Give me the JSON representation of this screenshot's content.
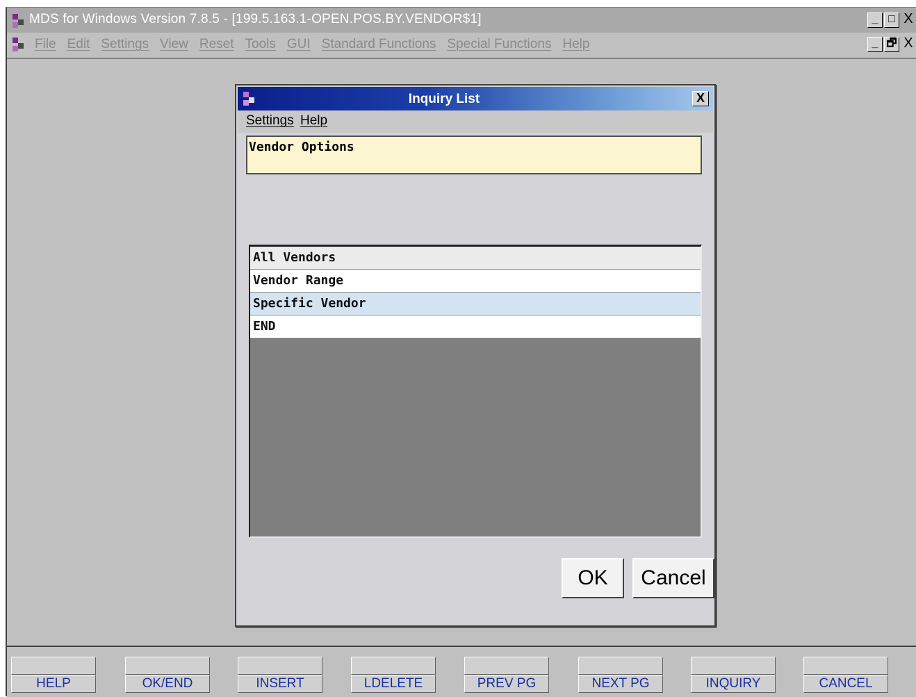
{
  "window": {
    "title": "MDS for Windows Version 7.8.5 - [199.5.163.1-OPEN.POS.BY.VENDOR$1]",
    "controls": {
      "minimize": "_",
      "maximize": "□",
      "restore": "🗗",
      "close": "X"
    }
  },
  "menubar": {
    "items": [
      "File",
      "Edit",
      "Settings",
      "View",
      "Reset",
      "Tools",
      "GUI",
      "Standard Functions",
      "Special Functions",
      "Help"
    ]
  },
  "dialog": {
    "title": "Inquiry List",
    "close": "X",
    "menu": [
      "Settings",
      "Help"
    ],
    "options_title": "Vendor Options",
    "list": [
      {
        "label": "All Vendors"
      },
      {
        "label": "Vendor Range"
      },
      {
        "label": "Specific Vendor"
      },
      {
        "label": "END"
      }
    ],
    "ok_label": "OK",
    "cancel_label": "Cancel"
  },
  "function_keys": [
    "HELP",
    "OK/END",
    "INSERT",
    "LDELETE",
    "PREV PG",
    "NEXT PG",
    "INQUIRY",
    "CANCEL"
  ],
  "colors": {
    "accent": "#0a1e8c",
    "options_bg": "#fbf6d0",
    "selected_row": "#d3e3f2",
    "fkey_text": "#1a2fa0"
  }
}
